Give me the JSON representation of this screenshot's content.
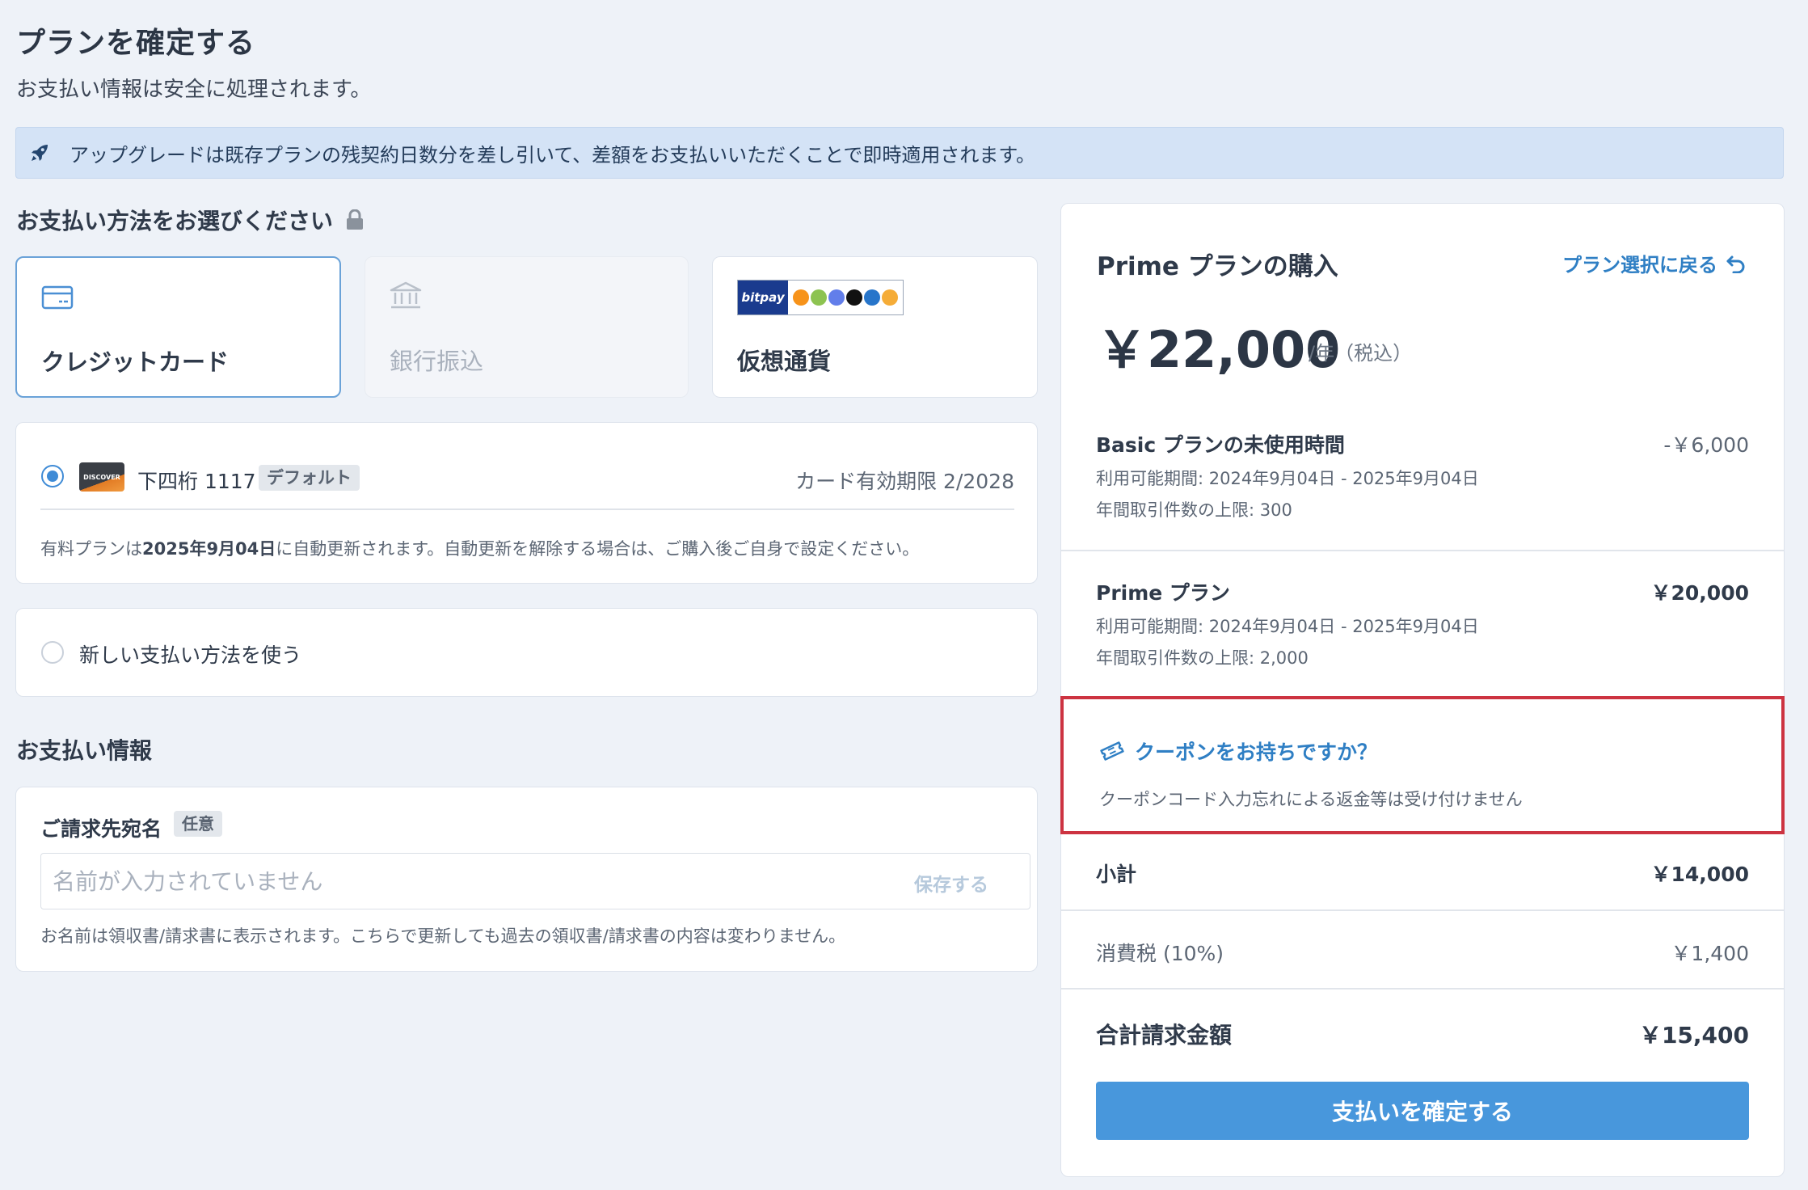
{
  "header": {
    "title": "プランを確定する",
    "subtitle": "お支払い情報は安全に処理されます。"
  },
  "notice": {
    "icon": "rocket-icon",
    "text": "アップグレードは既存プランの残契約日数分を差し引いて、差額をお支払いいただくことで即時適用されます。"
  },
  "payment_method": {
    "heading": "お支払い方法をお選びください",
    "options": [
      {
        "label": "クレジットカード",
        "icon": "credit-card-icon",
        "selected": true
      },
      {
        "label": "銀行振込",
        "icon": "bank-icon",
        "selected": false,
        "disabled": true
      },
      {
        "label": "仮想通貨",
        "icon": "bitpay-crypto-logo",
        "selected": false
      }
    ],
    "bitpay_text": "bitpay"
  },
  "saved_card": {
    "brand": "DISCOVER",
    "digits": "下四桁 1117",
    "badge": "デフォルト",
    "expiry": "カード有効期限 2/2028",
    "renew_prefix": "有料プランは",
    "renew_date": "2025年9月04日",
    "renew_suffix": "に自動更新されます。自動更新を解除する場合は、ご購入後ご自身で設定ください。"
  },
  "new_method": {
    "label": "新しい支払い方法を使う"
  },
  "billing": {
    "heading": "お支払い情報",
    "label": "ご請求先宛名",
    "badge": "任意",
    "placeholder": "名前が入力されていません",
    "value": "",
    "save": "保存する",
    "note": "お名前は領収書/請求書に表示されます。こちらで更新しても過去の領収書/請求書の内容は変わりません。"
  },
  "summary": {
    "title": "Prime プランの購入",
    "back": "プラン選択に戻る",
    "price": "￥22,000",
    "price_unit": "/年（税込）",
    "lines": [
      {
        "title": "Basic プランの未使用時間",
        "amount": "-￥6,000",
        "period": "利用可能期間: 2024年9月04日 - 2025年9月04日",
        "limit": "年間取引件数の上限: 300"
      },
      {
        "title": "Prime プラン",
        "amount": "￥20,000",
        "period": "利用可能期間: 2024年9月04日 - 2025年9月04日",
        "limit": "年間取引件数の上限: 2,000"
      }
    ],
    "coupon": {
      "link": "クーポンをお持ちですか？",
      "note": "クーポンコード入力忘れによる返金等は受け付けません"
    },
    "subtotal_label": "小計",
    "subtotal": "￥14,000",
    "tax_label": "消費税 (10%)",
    "tax": "￥1,400",
    "total_label": "合計請求金額",
    "total": "￥15,400",
    "confirm": "支払いを確定する"
  },
  "colors": {
    "accent": "#4897dc",
    "link": "#2f7fc4",
    "highlight": "#cd3341",
    "banner": "#d4e3f6",
    "background": "#eef2f8"
  }
}
